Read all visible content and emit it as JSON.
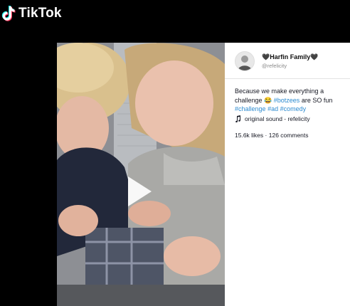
{
  "app": {
    "name": "TikTok"
  },
  "post": {
    "username": "🖤Harfin Family🖤",
    "handle": "@refelicity",
    "caption_text": "Because we make everything a challenge",
    "caption_emoji": "😂",
    "hashtags": [
      "#botzees",
      "are SO fun",
      "#challenge",
      "#ad",
      "#comedy"
    ],
    "sound": "original sound - refelicity",
    "likes": "15.6k likes",
    "separator": "·",
    "comments": "126 comments"
  },
  "colors": {
    "hashtag": "#2d8bd0",
    "background": "#000000",
    "panel": "#ffffff"
  },
  "icons": {
    "logo": "tiktok-note-icon",
    "play": "play-icon",
    "sound": "music-note-icon"
  }
}
